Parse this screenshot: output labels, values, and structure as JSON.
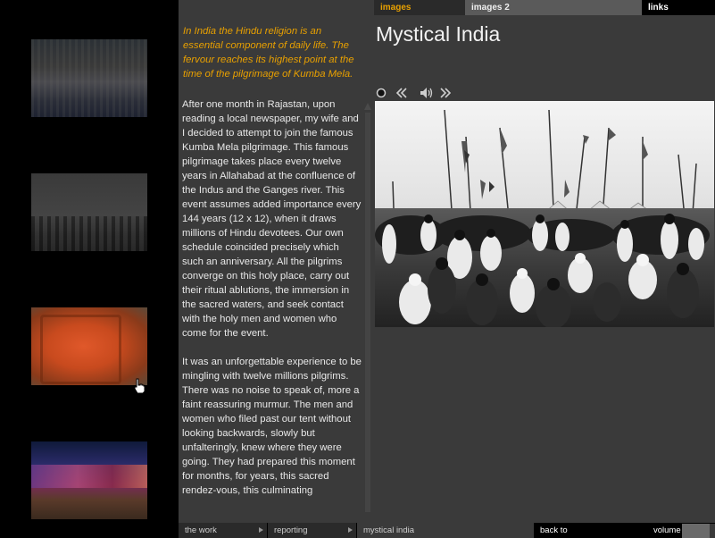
{
  "thumbnails": [
    {
      "name": "crowd-at-camp"
    },
    {
      "name": "flags-over-crowd"
    },
    {
      "name": "orange-ganesh-carving"
    },
    {
      "name": "colorful-saris"
    }
  ],
  "tabs": {
    "images": "images",
    "images2": "images 2",
    "links": "links"
  },
  "page": {
    "title": "Mystical India"
  },
  "intro": "In India the Hindu religion is an essential component of daily life. The fervour reaches its highest point at the time of the pilgrimage of Kumba Mela.",
  "body": {
    "p1": "After one month in Rajastan, upon reading a local newspaper, my wife and I decided to attempt to join the famous Kumba Mela pilgrimage. This famous pilgrimage takes place every twelve years in Allahabad at the confluence of the Indus and the Ganges river. This event assumes added importance every 144 years (12 x 12), when it draws millions of Hindu devotees. Our own schedule coincided precisely which such an anniversary. All the pilgrims converge on this holy place, carry out their ritual ablutions, the immersion in the sacred waters, and seek contact with the holy men and women who come for the event.",
    "p2": "It was an unforgettable experience to be mingling with twelve millions pilgrims. There was no noise to speak of, more a faint reassuring murmur. The men and women who filed past our tent without looking backwards, slowly but unfalteringly, knew where they were going. They had prepared this moment for months, for years, this sacred rendez-vous, this culminating"
  },
  "controls": [
    "record-icon",
    "rewind-icon",
    "sound-icon",
    "forward-icon"
  ],
  "bottom": {
    "work": "the work",
    "reporting": "reporting",
    "mystical": "mystical india",
    "back": "back to",
    "volume": "volume"
  },
  "volume_level": 0.85,
  "colors": {
    "accent": "#e8a000",
    "panel": "#3a3a3a",
    "background": "#000000"
  }
}
